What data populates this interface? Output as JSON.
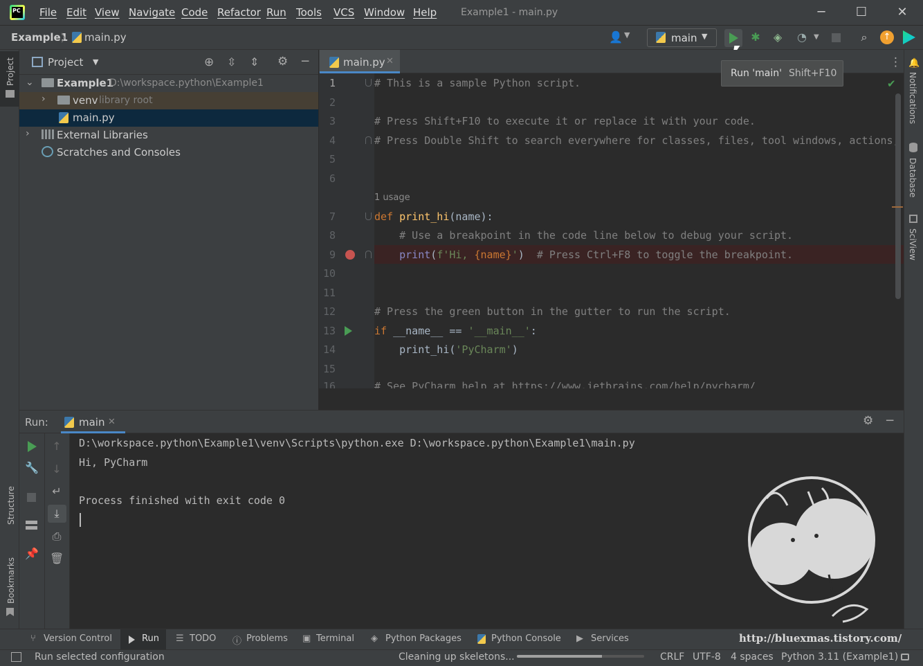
{
  "menu": [
    "File",
    "Edit",
    "View",
    "Navigate",
    "Code",
    "Refactor",
    "Run",
    "Tools",
    "VCS",
    "Window",
    "Help"
  ],
  "window_title": "Example1 - main.py",
  "breadcrumb": {
    "project": "Example1",
    "file": "main.py"
  },
  "run_config": "main",
  "tooltip": {
    "text": "Run 'main'",
    "shortcut": "Shift+F10"
  },
  "left_stripe": {
    "project": "Project",
    "structure": "Structure",
    "bookmarks": "Bookmarks"
  },
  "right_stripe": {
    "notifications": "Notifications",
    "database": "Database",
    "sciview": "SciView"
  },
  "project_panel": {
    "title": "Project",
    "tree": {
      "root_name": "Example1",
      "root_path": "D:\\workspace.python\\Example1",
      "venv": "venv",
      "venv_hint": "library root",
      "file": "main.py",
      "external": "External Libraries",
      "scratches": "Scratches and Consoles"
    }
  },
  "editor": {
    "tab": "main.py",
    "line_numbers": [
      "1",
      "2",
      "3",
      "4",
      "5",
      "6",
      "7",
      "8",
      "9",
      "10",
      "11",
      "12",
      "13",
      "14",
      "15",
      "16"
    ],
    "usage_hint": "1 usage",
    "lines": {
      "l1": "# This is a sample Python script.",
      "l3": "# Press Shift+F10 to execute it or replace it with your code.",
      "l4": "# Press Double Shift to search everywhere for classes, files, tool windows, actions, and settings.",
      "l7_kw": "def ",
      "l7_fn": "print_hi",
      "l7_rest": "(name):",
      "l8": "    # Use a breakpoint in the code line below to debug your script.",
      "l9_indent": "    ",
      "l9_bi": "print",
      "l9_open": "(",
      "l9_str1": "f'Hi, ",
      "l9_var": "{name}",
      "l9_str2": "'",
      "l9_close": ")  ",
      "l9_cm": "# Press Ctrl+F8 to toggle the breakpoint.",
      "l12": "# Press the green button in the gutter to run the script.",
      "l13_kw": "if ",
      "l13_mid": "__name__ == ",
      "l13_str": "'__main__'",
      "l13_end": ":",
      "l14_a": "    print_hi(",
      "l14_str": "'PyCharm'",
      "l14_b": ")",
      "l16": "# See PyCharm help at https://www.jetbrains.com/help/pycharm/"
    }
  },
  "run_panel": {
    "label": "Run:",
    "tab": "main",
    "console": [
      "D:\\workspace.python\\Example1\\venv\\Scripts\\python.exe D:\\workspace.python\\Example1\\main.py",
      "Hi, PyCharm",
      "",
      "Process finished with exit code 0"
    ]
  },
  "bottom_tabs": [
    "Version Control",
    "Run",
    "TODO",
    "Problems",
    "Terminal",
    "Python Packages",
    "Python Console",
    "Services"
  ],
  "watermark": "http://bluexmas.tistory.com/",
  "status_bar": {
    "message": "Run selected configuration",
    "task": "Cleaning up skeletons...",
    "progress": 0.67,
    "line_sep": "CRLF",
    "encoding": "UTF-8",
    "indent": "4 spaces",
    "interpreter": "Python 3.11 (Example1)"
  },
  "colors": {
    "accent": "#4a88c7",
    "run_green": "#499c54",
    "breakpoint": "#c75450"
  }
}
